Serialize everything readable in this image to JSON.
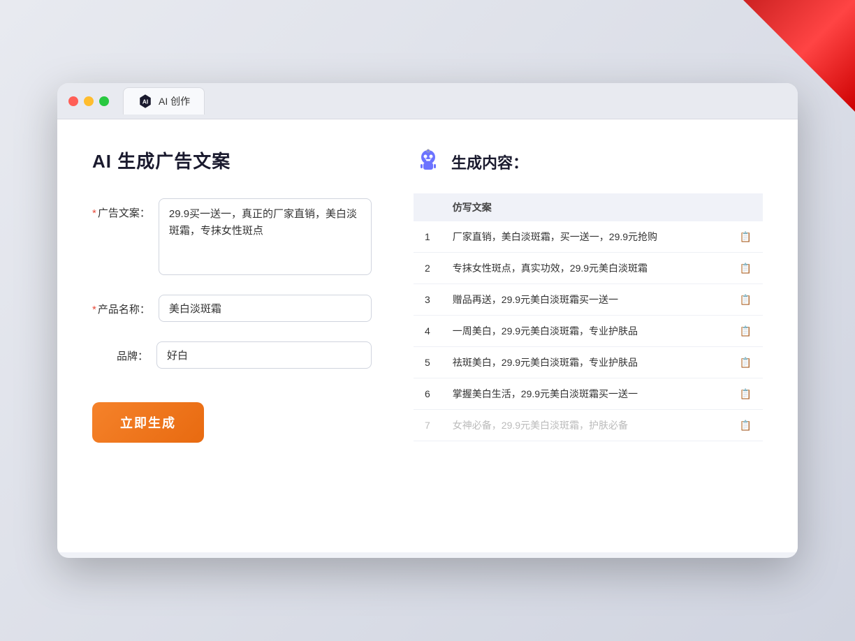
{
  "corner": "decorative",
  "window": {
    "tab_label": "AI 创作"
  },
  "page": {
    "title": "AI 生成广告文案",
    "form": {
      "ad_copy_label": "广告文案：",
      "ad_copy_required": "*",
      "ad_copy_value": "29.9买一送一，真正的厂家直销，美白淡斑霜，专抹女性斑点",
      "product_name_label": "产品名称：",
      "product_name_required": "*",
      "product_name_value": "美白淡斑霜",
      "brand_label": "品牌：",
      "brand_value": "好白",
      "generate_btn": "立即生成"
    },
    "result": {
      "title": "生成内容：",
      "col_header": "仿写文案",
      "items": [
        {
          "num": "1",
          "text": "厂家直销，美白淡斑霜，买一送一，29.9元抢购",
          "faded": false
        },
        {
          "num": "2",
          "text": "专抹女性斑点，真实功效，29.9元美白淡斑霜",
          "faded": false
        },
        {
          "num": "3",
          "text": "赠品再送，29.9元美白淡斑霜买一送一",
          "faded": false
        },
        {
          "num": "4",
          "text": "一周美白，29.9元美白淡斑霜，专业护肤品",
          "faded": false
        },
        {
          "num": "5",
          "text": "祛斑美白，29.9元美白淡斑霜，专业护肤品",
          "faded": false
        },
        {
          "num": "6",
          "text": "掌握美白生活，29.9元美白淡斑霜买一送一",
          "faded": false
        },
        {
          "num": "7",
          "text": "女神必备，29.9元美白淡斑霜，护肤必备",
          "faded": true
        }
      ]
    }
  }
}
